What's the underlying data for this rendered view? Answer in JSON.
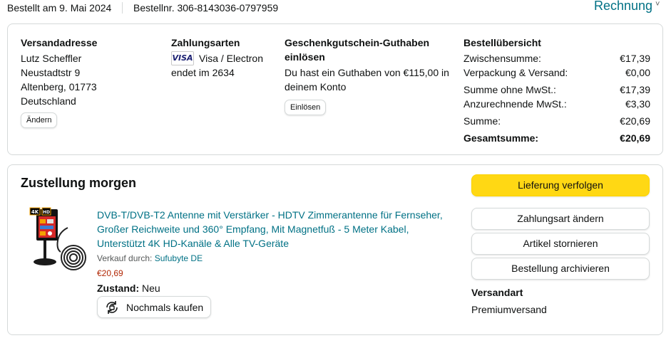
{
  "header": {
    "order_date": "Bestellt am 9. Mai 2024",
    "order_number": "Bestellnr. 306-8143036-0797959",
    "invoice_label": "Rechnung",
    "invoice_chevron": "˅"
  },
  "shipping_address": {
    "heading": "Versandadresse",
    "lines": [
      "Lutz Scheffler",
      "Neustadtstr 9",
      "Altenberg, 01773",
      "Deutschland"
    ],
    "change_button": "Ändern"
  },
  "payment": {
    "heading": "Zahlungsarten",
    "card_logo": "VISA",
    "card_type": "Visa / Electron",
    "card_ending": "endet im 2634"
  },
  "gift_card": {
    "heading": "Geschenkgutschein-Guthaben einlösen",
    "text": "Du hast ein Guthaben von €115,00 in deinem Konto",
    "redeem_button": "Einlösen"
  },
  "summary": {
    "heading": "Bestellübersicht",
    "rows": [
      {
        "label": "Zwischensumme:",
        "value": "€17,39"
      },
      {
        "label": "Verpackung & Versand:",
        "value": "€0,00"
      },
      {
        "label": "Summe ohne MwSt.:",
        "value": "€17,39"
      },
      {
        "label": "Anzurechnende MwSt.:",
        "value": "€3,30"
      },
      {
        "label": "Summe:",
        "value": "€20,69"
      },
      {
        "label": "Gesamtsumme:",
        "value": "€20,69"
      }
    ]
  },
  "delivery": {
    "title": "Zustellung morgen",
    "product": {
      "title": "DVB-T/DVB-T2 Antenne mit Verstärker - HDTV Zimmerantenne für Fernseher, Großer Reichweite und 360° Empfang, Mit Magnetfuß - 5 Meter Kabel, Unterstützt 4K HD-Kanäle & Alle TV-Geräte",
      "sold_by_label": "Verkauf durch:",
      "seller": "Sufubyte DE",
      "price": "€20,69",
      "condition_label": "Zustand:",
      "condition": "Neu",
      "buy_again": "Nochmals kaufen",
      "image_badges": [
        "4K",
        "HD"
      ]
    },
    "actions": {
      "track": "Lieferung verfolgen",
      "change_payment": "Zahlungsart ändern",
      "cancel": "Artikel stornieren",
      "archive": "Bestellung archivieren"
    },
    "shipping_method_label": "Versandart",
    "shipping_method": "Premiumversand"
  },
  "colors": {
    "link": "#007185",
    "price": "#b12704",
    "primary_button": "#ffd814",
    "border": "#d5d9d9"
  }
}
